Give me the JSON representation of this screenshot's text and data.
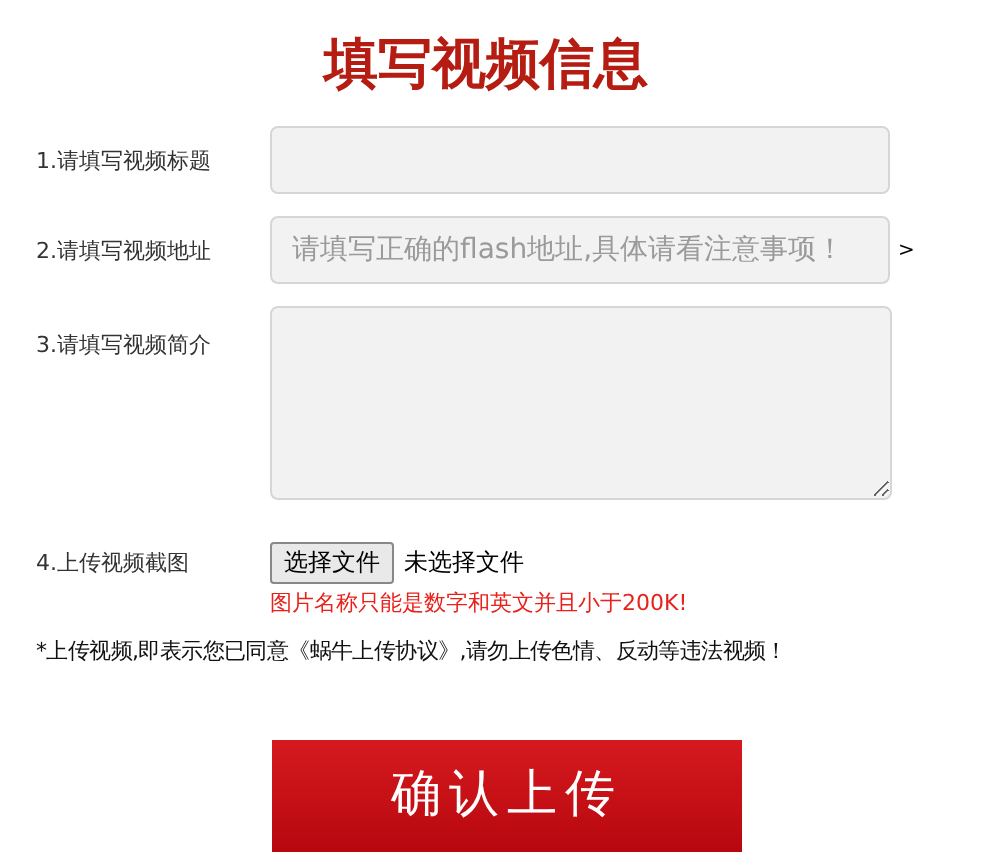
{
  "title": "填写视频信息",
  "fields": [
    {
      "kind": "input",
      "label": "1.请填写视频标题"
    },
    {
      "kind": "input",
      "label": "2.请填写视频地址",
      "placeholder": "请填写正确的flash地址,具体请看注意事项！",
      "suffix": ">"
    },
    {
      "kind": "textarea",
      "label": "3.请填写视频简介"
    },
    {
      "kind": "file",
      "label": "4.上传视频截图",
      "button": "选择文件",
      "status": "未选择文件",
      "hint": "图片名称只能是数字和英文并且小于200K!"
    }
  ],
  "notice": "*上传视频,即表示您已同意《蜗牛上传协议》,请勿上传色情、反动等违法视频！",
  "submit": "确认上传"
}
